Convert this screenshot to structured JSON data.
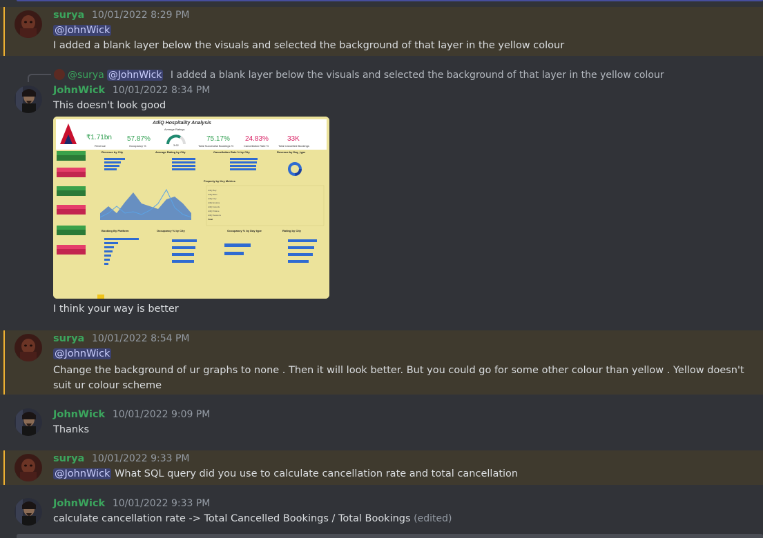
{
  "messages": [
    {
      "author": "surya",
      "timestamp": "10/01/2022 8:29 PM",
      "mention": "@JohnWick",
      "text": "I added a blank layer below the visuals and selected the background of that layer in the yellow colour"
    },
    {
      "reply": {
        "author": "@surya",
        "mention": "@JohnWick",
        "text": "I added a blank layer below the visuals and selected the background of that layer in the yellow colour"
      },
      "author": "JohnWick",
      "timestamp": "10/01/2022 8:34 PM",
      "text": "This doesn't look good",
      "text2": "I think your way is better"
    },
    {
      "author": "surya",
      "timestamp": "10/01/2022 8:54 PM",
      "mention": "@JohnWick",
      "text": "Change the background of ur graphs to none . Then it will look better. But you could go for some other colour than yellow . Yellow doesn't suit ur colour scheme"
    },
    {
      "author": "JohnWick",
      "timestamp": "10/01/2022 9:09 PM",
      "text": "Thanks"
    },
    {
      "author": "surya",
      "timestamp": "10/01/2022 9:33 PM",
      "mention": "@JohnWick",
      "text": "What SQL query did you use to calculate cancellation rate and total cancellation"
    },
    {
      "author": "JohnWick",
      "timestamp": "10/01/2022 9:33 PM",
      "text": "calculate cancellation rate -> Total Cancelled Bookings / Total Bookings",
      "edited": "(edited)"
    }
  ],
  "dashboard": {
    "title": "AtliQ Hospitality Analysis",
    "revenue": "₹1.71bn",
    "revenue_label": "Revenue",
    "occupancy": "57.87%",
    "occupancy_label": "Occupancy %",
    "avg_ratings_label": "Average Ratings",
    "rating": "3.62",
    "success": "75.17%",
    "success_label": "Total Successful Bookings %",
    "cancel": "24.83%",
    "cancel_label": "Cancellation Rate %",
    "cancelled": "33K",
    "cancelled_label": "Total Cancelled Bookings",
    "sections": [
      "Revenue by City",
      "Average Rating by City",
      "Cancellation Rate % by City",
      "Revenue by Day_type",
      "Property by Key Metrics",
      "Booking By Platform",
      "Occupancy % by City",
      "Occupancy % by Day type",
      "Rating by City"
    ],
    "filters": [
      "Property Name",
      "Room",
      "Month",
      "Booking Platform",
      "City",
      "Cancelled Booking"
    ]
  }
}
